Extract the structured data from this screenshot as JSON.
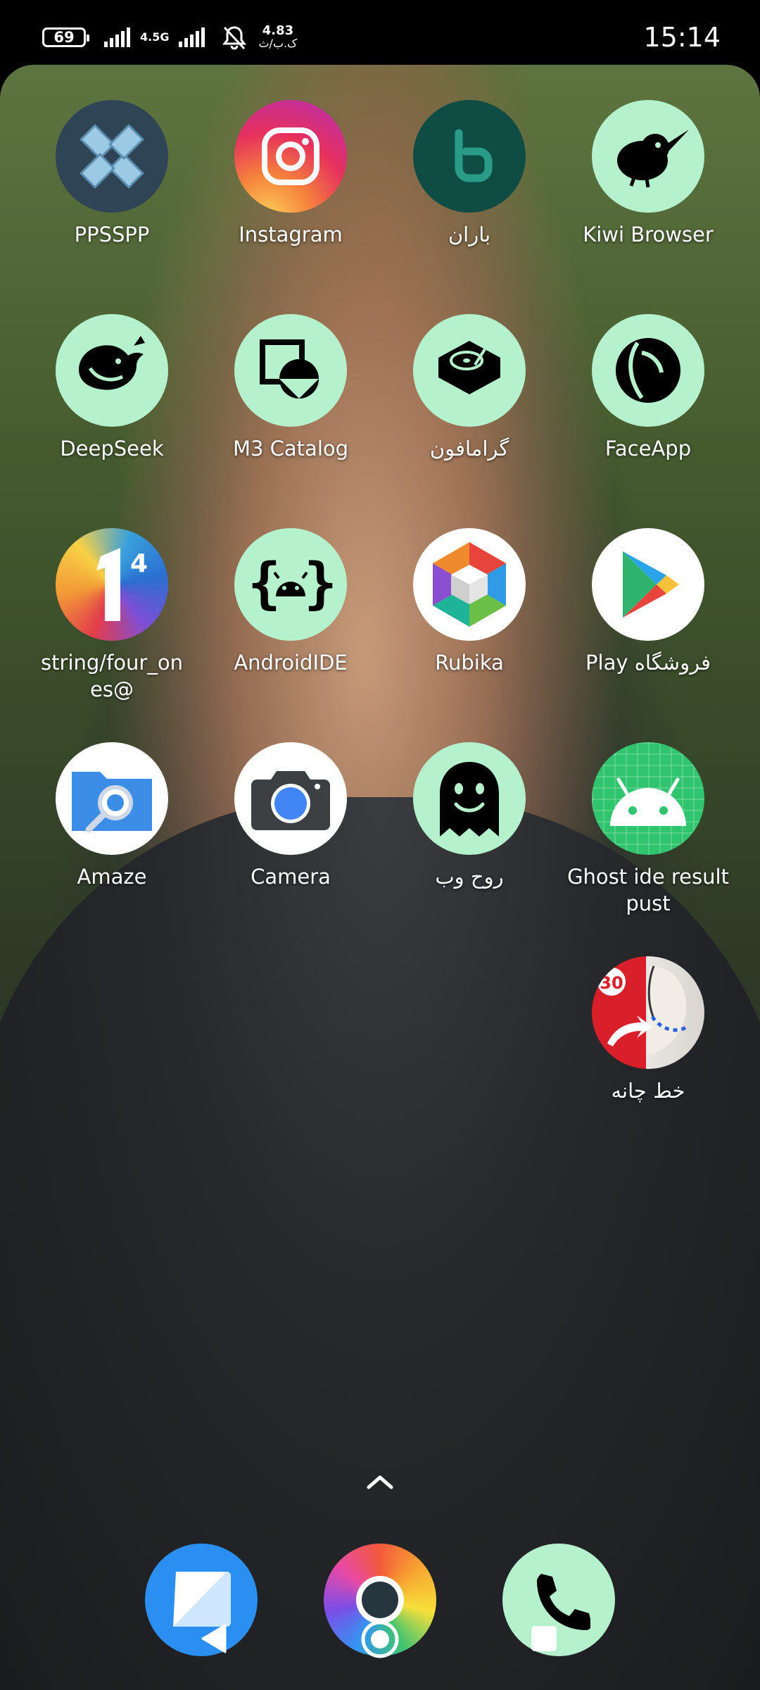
{
  "status_bar": {
    "battery": "69",
    "network": "4.5G",
    "speed_value": "4.83",
    "speed_unit": "ک.ب/ث",
    "time": "15:14"
  },
  "apps": [
    {
      "label": "PPSSPP",
      "icon": "ppsspp-icon"
    },
    {
      "label": "Instagram",
      "icon": "instagram-icon"
    },
    {
      "label": "باران",
      "icon": "baran-icon"
    },
    {
      "label": "Kiwi Browser",
      "icon": "kiwi-bird-icon"
    },
    {
      "label": "DeepSeek",
      "icon": "deepseek-whale-icon"
    },
    {
      "label": "M3 Catalog",
      "icon": "m3-catalog-icon"
    },
    {
      "label": "گرامافون",
      "icon": "turntable-icon"
    },
    {
      "label": "FaceApp",
      "icon": "faceapp-icon"
    },
    {
      "label": "string/four_ones@",
      "icon": "number-one-icon"
    },
    {
      "label": "AndroidIDE",
      "icon": "android-braces-icon"
    },
    {
      "label": "Rubika",
      "icon": "rubika-cube-icon"
    },
    {
      "label": "Play فروشگاه",
      "icon": "play-store-icon"
    },
    {
      "label": "Amaze",
      "icon": "folder-search-icon"
    },
    {
      "label": "Camera",
      "icon": "camera-icon"
    },
    {
      "label": "روح وب",
      "icon": "ghost-icon"
    },
    {
      "label": "Ghost ide result pust",
      "icon": "android-grid-icon"
    },
    {
      "label": "خط چانه",
      "icon": "jawline-face-icon"
    }
  ],
  "dock": [
    {
      "icon": "messages-icon"
    },
    {
      "icon": "browser-icon"
    },
    {
      "icon": "phone-icon"
    }
  ],
  "colors": {
    "mint_icon_bg": "#b5f1cc",
    "status_bar_bg": "#000000"
  }
}
